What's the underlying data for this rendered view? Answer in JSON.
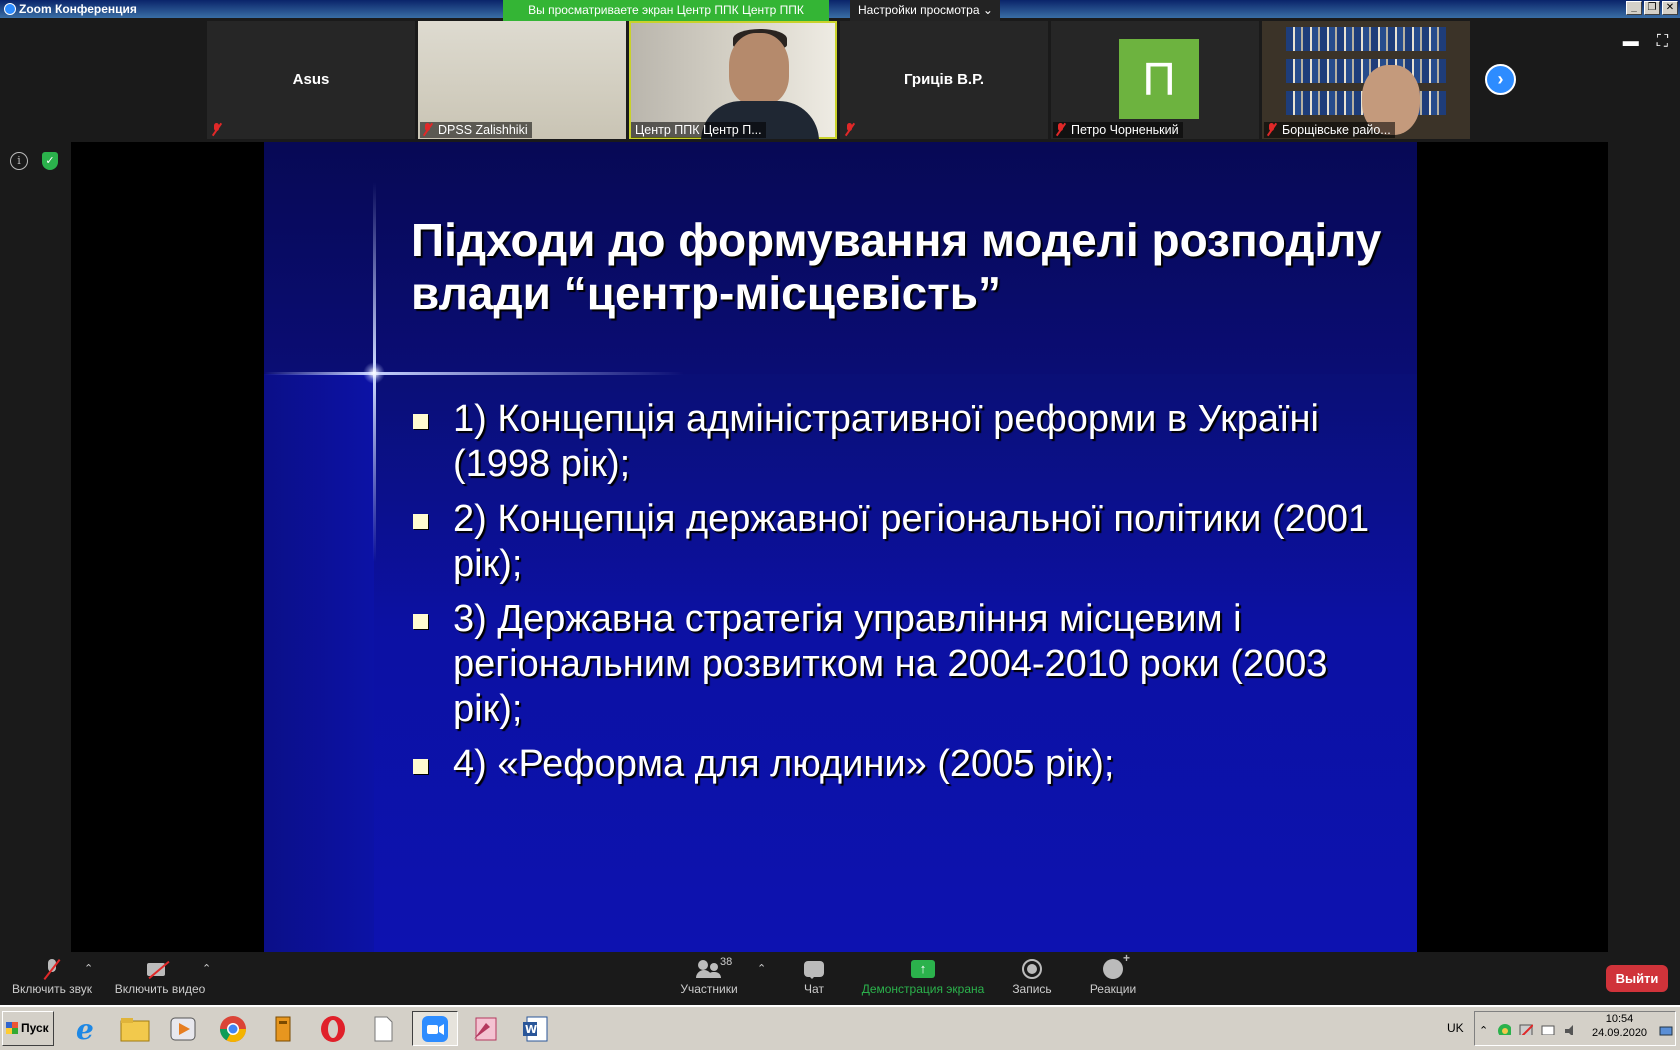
{
  "window": {
    "title": "Zoom Конференция",
    "share_banner": "Вы просматриваете экран Центр ППК Центр ППК",
    "view_options": "Настройки просмотра ⌄",
    "buttons": [
      "_",
      "❐",
      "✕"
    ]
  },
  "participants": [
    {
      "name": "Asus",
      "label": "",
      "muted": true,
      "kind": "name-only"
    },
    {
      "name": "",
      "label": "DPSS Zalishhiki",
      "muted": true,
      "kind": "video-wall"
    },
    {
      "name": "",
      "label": "Центр ППК Центр П...",
      "muted": false,
      "kind": "video-speaker"
    },
    {
      "name": "Гриців В.Р.",
      "label": "",
      "muted": true,
      "kind": "name-only"
    },
    {
      "name": "",
      "label": "Петро Чорненький",
      "muted": true,
      "kind": "avatar",
      "avatar_letter": "П"
    },
    {
      "name": "",
      "label": "Борщівське райо...",
      "muted": true,
      "kind": "video-library"
    }
  ],
  "next_page_icon": "›",
  "slide": {
    "title": "Підходи до формування моделі розподілу влади “центр-місцевість”",
    "bullets": [
      "1) Концепція адміністративної реформи в Україні (1998 рік);",
      "2) Концепція державної регіональної політики (2001 рік);",
      "3) Державна стратегія управління місцевим і регіональним розвитком на 2004-2010 роки (2003 рік);",
      "4) «Реформа для людини» (2005 рік);"
    ]
  },
  "toolbar": {
    "unmute": "Включить звук",
    "start_video": "Включить видео",
    "participants": "Участники",
    "participants_count": "38",
    "chat": "Чат",
    "share_screen": "Демонстрация экрана",
    "record": "Запись",
    "reactions": "Реакции",
    "leave": "Выйти"
  },
  "taskbar": {
    "start": "Пуск",
    "language": "UK",
    "time": "10:54",
    "date": "24.09.2020"
  },
  "colors": {
    "zoom_blue": "#2d8cff",
    "share_green": "#34b535",
    "leave_red": "#d0333a",
    "slide_bg": "#0c11a3"
  }
}
